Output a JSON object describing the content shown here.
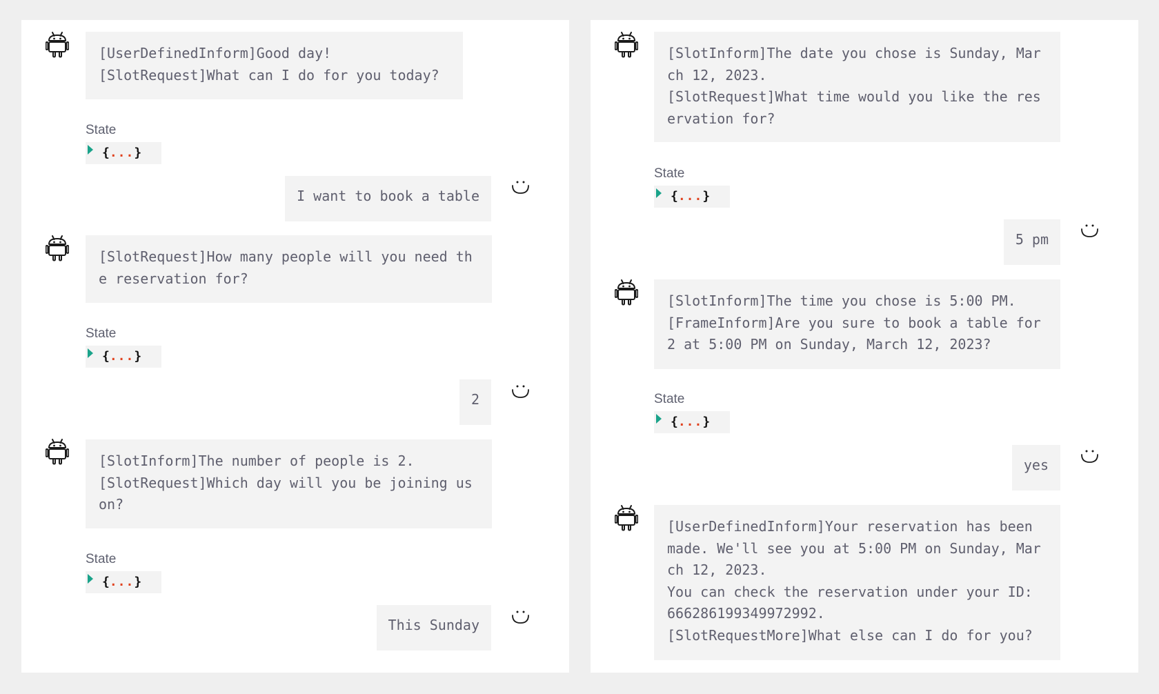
{
  "state_label": "State",
  "state_collapsed": {
    "open": "{",
    "dots": "...",
    "close": "}"
  },
  "colors": {
    "page_bg": "#efefef",
    "panel_bg": "#ffffff",
    "bubble_bg": "#f3f3f3",
    "text": "#5f5f6e",
    "toggle_accent": "#1aa38a",
    "ellipsis": "#e0421f"
  },
  "icons": {
    "bot": "android-robot-icon",
    "user": "smiley-face-icon"
  },
  "left_panel": {
    "messages": [
      {
        "role": "bot",
        "text": "[UserDefinedInform]Good day!\n[SlotRequest]What can I do for you today?"
      },
      {
        "role": "user",
        "text": "I want to book a table"
      },
      {
        "role": "bot",
        "text": "[SlotRequest]How many people will you need the reservation for?"
      },
      {
        "role": "user",
        "text": "2"
      },
      {
        "role": "bot",
        "text": "[SlotInform]The number of people is 2.\n[SlotRequest]Which day will you be joining us on?"
      },
      {
        "role": "user",
        "text": "This Sunday"
      }
    ]
  },
  "right_panel": {
    "messages": [
      {
        "role": "bot",
        "text": "[SlotInform]The date you chose is Sunday, March 12, 2023.\n[SlotRequest]What time would you like the reservation for?"
      },
      {
        "role": "user",
        "text": "5 pm"
      },
      {
        "role": "bot",
        "text": "[SlotInform]The time you chose is 5:00 PM.\n[FrameInform]Are you sure to book a table for 2 at 5:00 PM on Sunday, March 12, 2023?"
      },
      {
        "role": "user",
        "text": "yes"
      },
      {
        "role": "bot",
        "text": "[UserDefinedInform]Your reservation has been made. We'll see you at 5:00 PM on Sunday, March 12, 2023.\nYou can check the reservation under your ID: 666286199349972992.\n[SlotRequestMore]What else can I do for you?"
      }
    ]
  }
}
